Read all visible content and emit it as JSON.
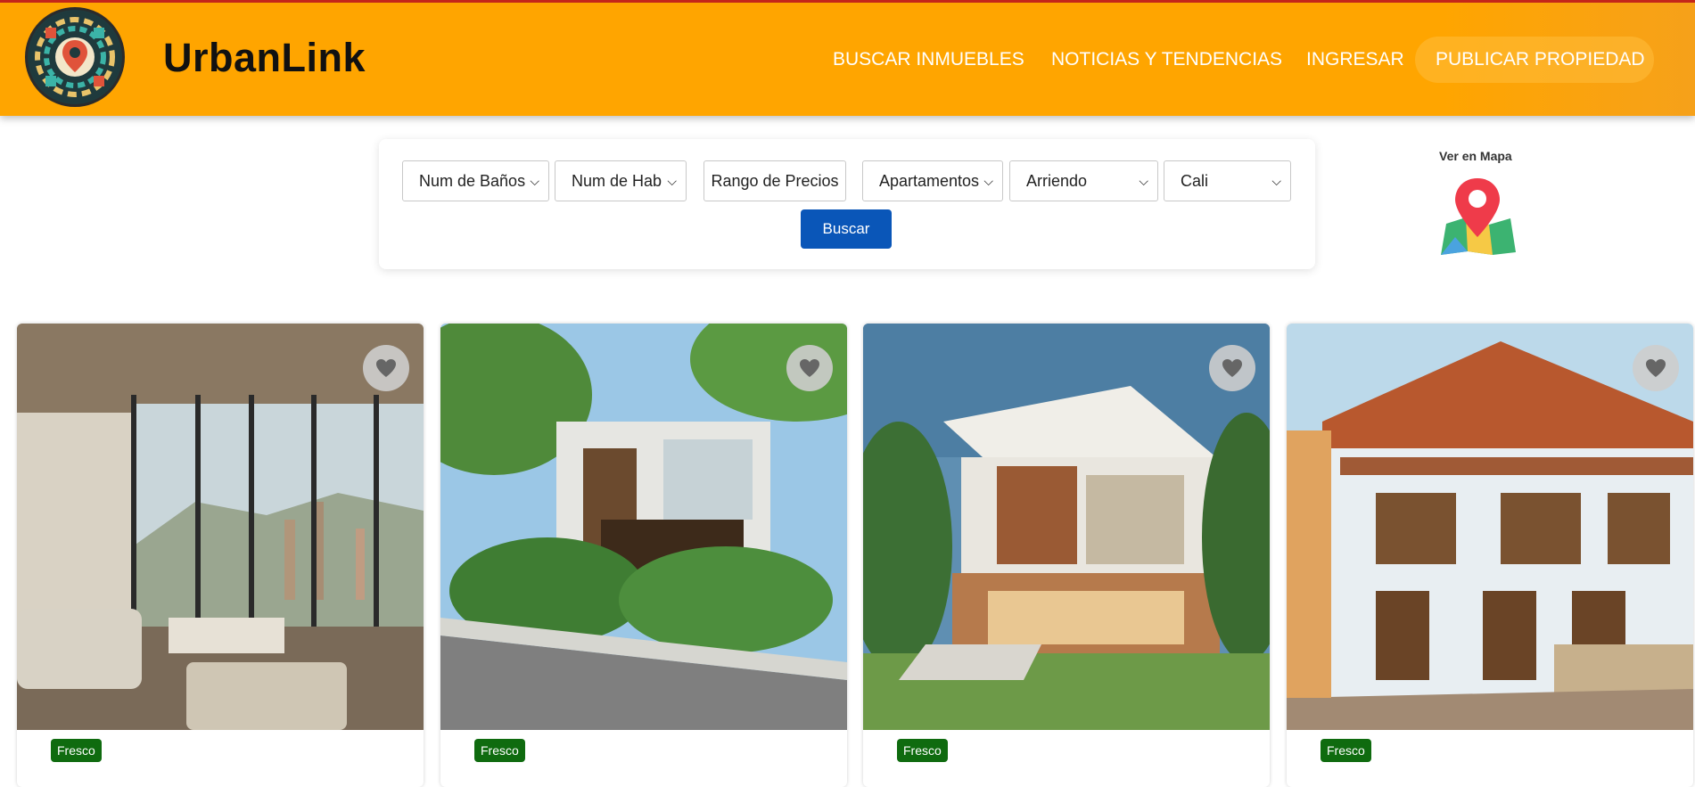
{
  "header": {
    "brand": "UrbanLink",
    "nav": [
      {
        "label": "BUSCAR INMUEBLES"
      },
      {
        "label": "NOTICIAS Y TENDENCIAS"
      },
      {
        "label": "INGRESAR"
      },
      {
        "label": "PUBLICAR PROPIEDAD"
      }
    ]
  },
  "filters": {
    "banos": "Num de Baños",
    "habitaciones": "Num de Hab",
    "precio": "Rango de Precios",
    "tipo": "Apartamentos",
    "operacion": "Arriendo",
    "ciudad": "Cali",
    "search_button": "Buscar"
  },
  "map": {
    "label": "Ver en Mapa"
  },
  "cards": [
    {
      "badge": "Fresco"
    },
    {
      "badge": "Fresco"
    },
    {
      "badge": "Fresco"
    },
    {
      "badge": "Fresco"
    }
  ],
  "colors": {
    "header": "#ffa500",
    "button": "#0a56b8",
    "badge": "#0f6b0f"
  }
}
